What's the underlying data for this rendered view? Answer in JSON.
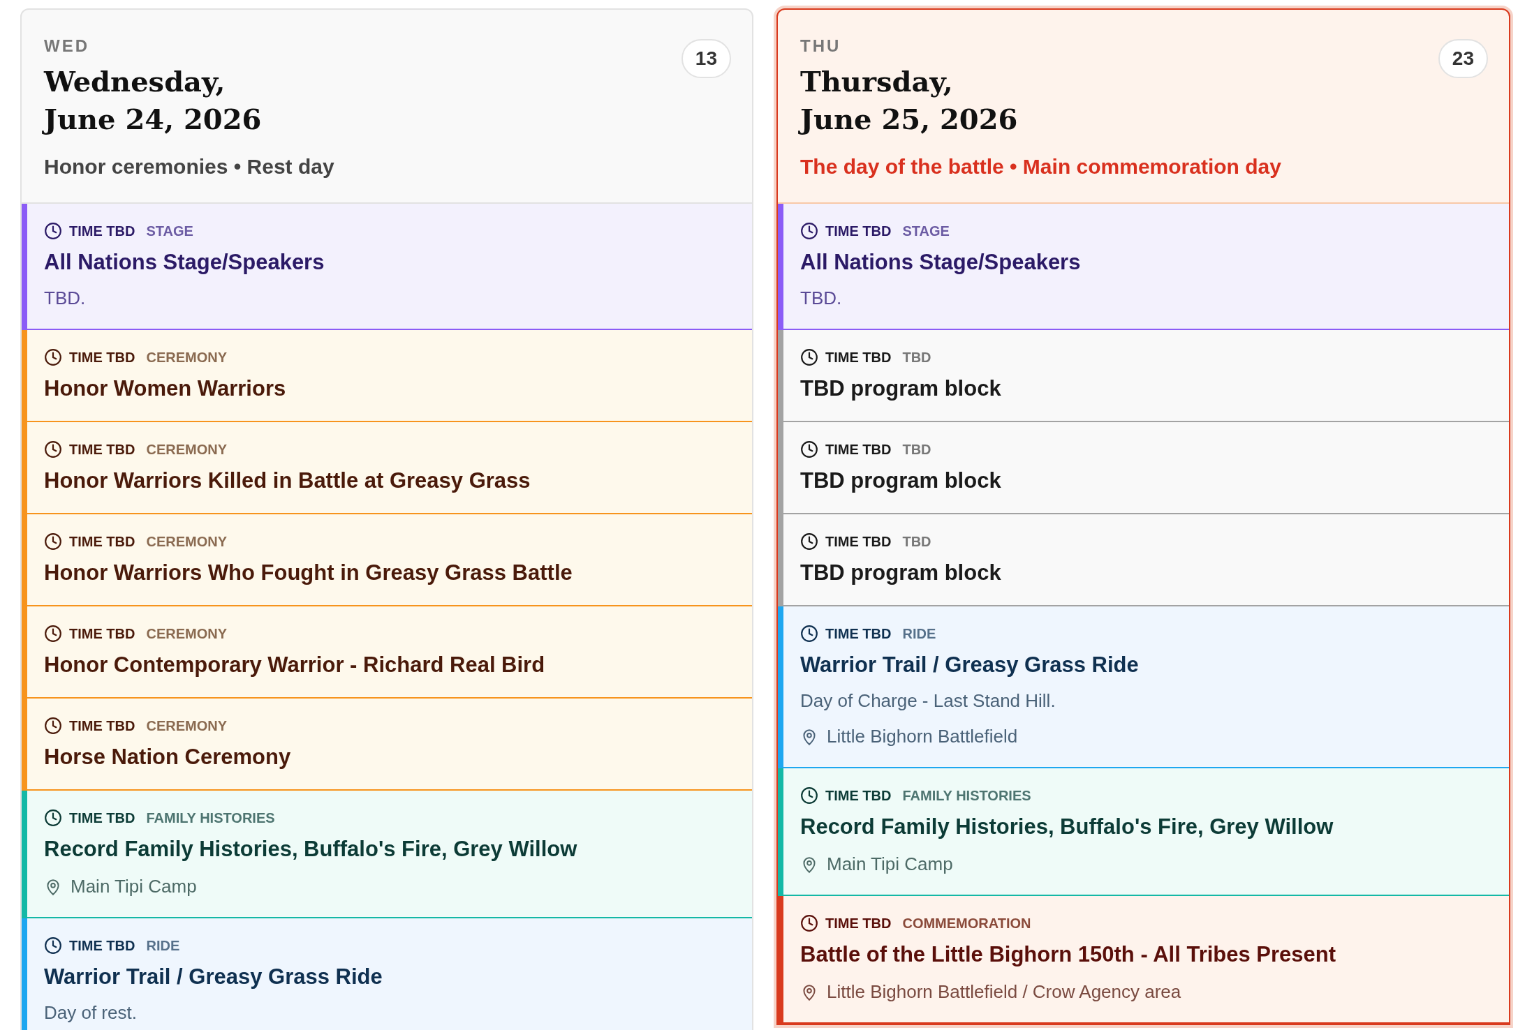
{
  "days": [
    {
      "abbr": "WED",
      "title_line1": "Wednesday,",
      "title_line2": "June 24, 2026",
      "count": "13",
      "subtitle": "Honor ceremonies • Rest day",
      "highlighted": false,
      "events": [
        {
          "kind": "stage",
          "color": "#8b5cf6",
          "time": "TIME TBD",
          "category": "STAGE",
          "title": "All Nations Stage/Speakers",
          "description": "TBD."
        },
        {
          "kind": "ceremony",
          "color": "#f7941d",
          "time": "TIME TBD",
          "category": "CEREMONY",
          "title": "Honor Women Warriors"
        },
        {
          "kind": "ceremony",
          "color": "#f7941d",
          "time": "TIME TBD",
          "category": "CEREMONY",
          "title": "Honor Warriors Killed in Battle at Greasy Grass"
        },
        {
          "kind": "ceremony",
          "color": "#f7941d",
          "time": "TIME TBD",
          "category": "CEREMONY",
          "title": "Honor Warriors Who Fought in Greasy Grass Battle"
        },
        {
          "kind": "ceremony",
          "color": "#f7941d",
          "time": "TIME TBD",
          "category": "CEREMONY",
          "title": "Honor Contemporary Warrior - Richard Real Bird"
        },
        {
          "kind": "ceremony",
          "color": "#f7941d",
          "time": "TIME TBD",
          "category": "CEREMONY",
          "title": "Horse Nation Ceremony"
        },
        {
          "kind": "family",
          "color": "#14b8a6",
          "time": "TIME TBD",
          "category": "FAMILY HISTORIES",
          "title": "Record Family Histories, Buffalo's Fire, Grey Willow",
          "location": "Main Tipi Camp"
        },
        {
          "kind": "ride",
          "color": "#1ea7f0",
          "time": "TIME TBD",
          "category": "RIDE",
          "title": "Warrior Trail / Greasy Grass Ride",
          "description": "Day of rest."
        }
      ]
    },
    {
      "abbr": "THU",
      "title_line1": "Thursday,",
      "title_line2": "June 25, 2026",
      "count": "23",
      "subtitle": "The day of the battle • Main commemoration day",
      "highlighted": true,
      "events": [
        {
          "kind": "stage",
          "color": "#8b5cf6",
          "time": "TIME TBD",
          "category": "STAGE",
          "title": "All Nations Stage/Speakers",
          "description": "TBD."
        },
        {
          "kind": "tbd",
          "color": "#a3a3a3",
          "time": "TIME TBD",
          "category": "TBD",
          "title": "TBD program block"
        },
        {
          "kind": "tbd",
          "color": "#a3a3a3",
          "time": "TIME TBD",
          "category": "TBD",
          "title": "TBD program block"
        },
        {
          "kind": "tbd",
          "color": "#a3a3a3",
          "time": "TIME TBD",
          "category": "TBD",
          "title": "TBD program block"
        },
        {
          "kind": "ride",
          "color": "#1ea7f0",
          "time": "TIME TBD",
          "category": "RIDE",
          "title": "Warrior Trail / Greasy Grass Ride",
          "description": "Day of Charge - Last Stand Hill.",
          "location": "Little Bighorn Battlefield"
        },
        {
          "kind": "family",
          "color": "#14b8a6",
          "time": "TIME TBD",
          "category": "FAMILY HISTORIES",
          "title": "Record Family Histories, Buffalo's Fire, Grey Willow",
          "location": "Main Tipi Camp"
        },
        {
          "kind": "commemoration",
          "color": "#d93a1e",
          "time": "TIME TBD",
          "category": "COMMEMORATION",
          "title": "Battle of the Little Bighorn 150th - All Tribes Present",
          "location": "Little Bighorn Battlefield / Crow Agency area"
        }
      ]
    }
  ]
}
